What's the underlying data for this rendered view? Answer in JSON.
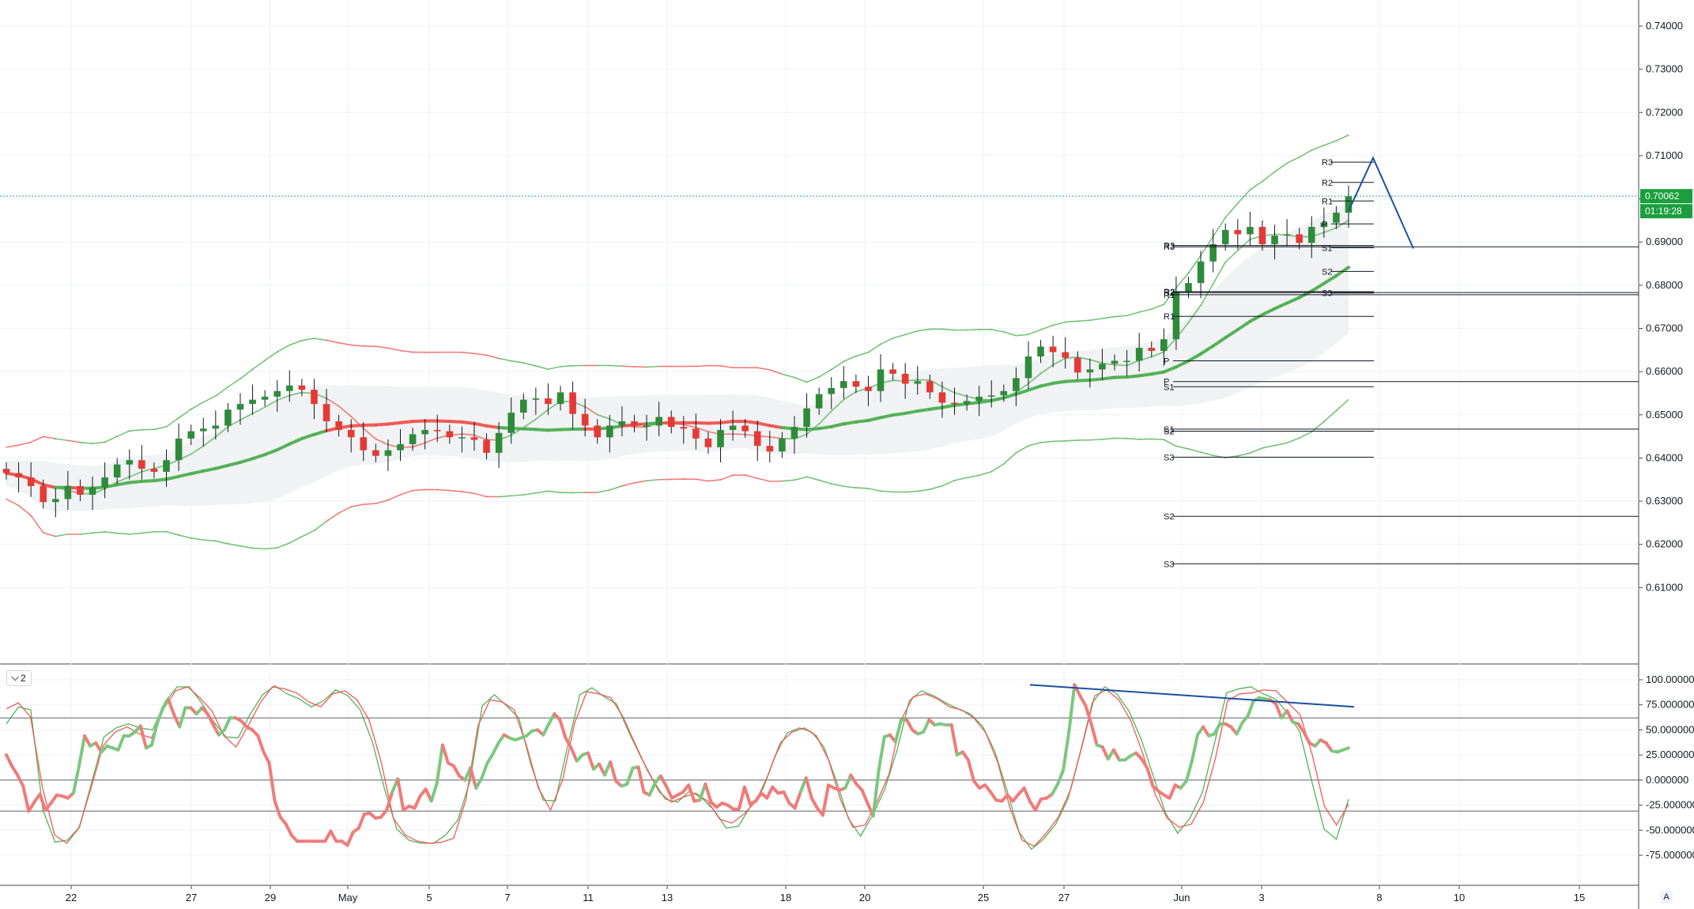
{
  "chart_data": [
    {
      "type": "candlestick",
      "title": "",
      "x_tick_labels": [
        "22",
        "27",
        "29",
        "May",
        "5",
        "7",
        "11",
        "13",
        "18",
        "20",
        "25",
        "27",
        "Jun",
        "3",
        "8",
        "10",
        "15"
      ],
      "y_tick_labels": [
        "0.74000",
        "0.73000",
        "0.72000",
        "0.71000",
        "0.70000",
        "0.69000",
        "0.68000",
        "0.67000",
        "0.66000",
        "0.65000",
        "0.64000",
        "0.63000",
        "0.62000",
        "0.61000"
      ],
      "ylim": [
        0.605,
        0.745
      ],
      "last_price": "0.70062",
      "countdown": "01:19:28",
      "series": [
        {
          "label_description": "close (approx.)",
          "values": [
            0.6365,
            0.6355,
            0.6335,
            0.6298,
            0.6305,
            0.6335,
            0.6315,
            0.6332,
            0.6355,
            0.6385,
            0.6395,
            0.6375,
            0.6368,
            0.6395,
            0.6445,
            0.6462,
            0.6468,
            0.6475,
            0.6512,
            0.6525,
            0.6535,
            0.6542,
            0.6555,
            0.6568,
            0.6558,
            0.6525,
            0.6485,
            0.6465,
            0.6448,
            0.6418,
            0.6405,
            0.6418,
            0.6432,
            0.6455,
            0.6465,
            0.6462,
            0.6448,
            0.6448,
            0.6442,
            0.6412,
            0.6458,
            0.6505,
            0.6535,
            0.6538,
            0.6525,
            0.6552,
            0.6502,
            0.6475,
            0.6448,
            0.6475,
            0.6485,
            0.6475,
            0.6475,
            0.6495,
            0.6472,
            0.6468,
            0.6445,
            0.6425,
            0.6465,
            0.6475,
            0.6462,
            0.6428,
            0.6415,
            0.6445,
            0.6472,
            0.6515,
            0.6548,
            0.6562,
            0.6578,
            0.6565,
            0.6555,
            0.6605,
            0.6595,
            0.6572,
            0.6578,
            0.6552,
            0.6528,
            0.6525,
            0.6532,
            0.6542,
            0.6545,
            0.6555,
            0.6585,
            0.6635,
            0.6658,
            0.6645,
            0.6632,
            0.6598,
            0.6605,
            0.6618,
            0.6625,
            0.6625,
            0.6655,
            0.6648,
            0.6675,
            0.6785,
            0.6805,
            0.6855,
            0.6895,
            0.6928,
            0.6918,
            0.6935,
            0.6895,
            0.6915,
            0.6918,
            0.6898,
            0.6935,
            0.6945,
            0.6968,
            0.7006
          ]
        }
      ],
      "pivot_levels": {
        "week1": {
          "R3": 0.7085,
          "R2": 0.7038,
          "R1": 0.6995,
          "P": 0.6942,
          "S1": 0.6887,
          "S2": 0.6832,
          "S3": 0.6782
        },
        "week2": {
          "R3": 0.6892,
          "R2": 0.6785,
          "R1": 0.6728,
          "P": 0.6625,
          "S1": 0.6565,
          "S2": 0.6462,
          "S3": 0.6402
        },
        "week3": {
          "R3": 0.6889,
          "R2": 0.6783,
          "R1": 0.6778,
          "P": 0.6577,
          "S1": 0.6467,
          "S2": 0.6265,
          "S3": 0.6155
        }
      },
      "projection": {
        "points": [
          [
            0.6972
          ],
          [
            0.7095
          ],
          [
            0.6885
          ]
        ]
      }
    },
    {
      "type": "line",
      "title": "",
      "pane_label": "2",
      "y_tick_labels": [
        "100.000000",
        "75.000000",
        "50.000000",
        "25.000000",
        "0.000000",
        "-25.000000",
        "-50.000000",
        "-75.000000"
      ],
      "ylim": [
        -80,
        105
      ],
      "levels": [
        62,
        0,
        -31
      ],
      "series": [
        {
          "label_description": "main oscillator",
          "values": [
            25,
            14,
            5,
            -6,
            -31,
            -22,
            -14,
            -30,
            -23,
            -15,
            -16,
            -18,
            -13,
            14,
            44,
            34,
            37,
            28,
            34,
            32,
            30,
            44,
            44,
            48,
            54,
            32,
            35,
            57,
            72,
            80,
            65,
            53,
            72,
            72,
            66,
            72,
            66,
            55,
            45,
            50,
            62,
            62,
            59,
            53,
            50,
            44,
            28,
            17,
            -21,
            -37,
            -44,
            -55,
            -61,
            -61,
            -61,
            -61,
            -61,
            -61,
            -51,
            -61,
            -61,
            -65,
            -52,
            -48,
            -34,
            -33,
            -38,
            -37,
            -30,
            -12,
            1,
            -30,
            -26,
            -28,
            -16,
            -9,
            -21,
            -3,
            35,
            17,
            14,
            4,
            0,
            12,
            -8,
            2,
            17,
            26,
            37,
            45,
            42,
            40,
            42,
            44,
            49,
            50,
            45,
            56,
            66,
            60,
            42,
            32,
            19,
            25,
            27,
            11,
            16,
            5,
            18,
            -1,
            -6,
            -4,
            12,
            13,
            -12,
            -15,
            -3,
            4,
            -6,
            -18,
            -15,
            -12,
            -5,
            -21,
            -20,
            -4,
            -22,
            -27,
            -23,
            -25,
            -29,
            -29,
            -7,
            -24,
            -21,
            -13,
            -18,
            -7,
            -13,
            -12,
            -23,
            -28,
            -12,
            2,
            -18,
            -28,
            -35,
            -5,
            -8,
            -10,
            -8,
            5,
            -4,
            -10,
            -23,
            -36,
            10,
            43,
            45,
            38,
            60,
            60,
            50,
            46,
            48,
            60,
            55,
            56,
            55,
            55,
            25,
            28,
            20,
            -1,
            -8,
            -5,
            -12,
            -20,
            -21,
            -15,
            -21,
            -14,
            -8,
            -21,
            -30,
            -19,
            -18,
            -14,
            -4,
            10,
            48,
            95,
            84,
            74,
            56,
            35,
            33,
            21,
            30,
            20,
            20,
            24,
            27,
            21,
            12,
            -6,
            -11,
            -15,
            -18,
            -5,
            -8,
            -1,
            19,
            45,
            53,
            44,
            46,
            56,
            56,
            53,
            46,
            57,
            64,
            79,
            82,
            81,
            80,
            76,
            62,
            69,
            58,
            56,
            48,
            37,
            34,
            40,
            37,
            29,
            28,
            30,
            32
          ]
        },
        {
          "label_description": "fast line (red)",
          "values": [
            71,
            77,
            63,
            -8,
            -55,
            -63,
            -48,
            -8,
            34,
            48,
            53,
            46,
            42,
            71,
            89,
            93,
            82,
            69,
            44,
            33,
            54,
            77,
            93,
            91,
            87,
            78,
            73,
            86,
            89,
            80,
            60,
            18,
            -38,
            -55,
            -61,
            -63,
            -62,
            -58,
            -20,
            54,
            80,
            78,
            70,
            35,
            -8,
            -30,
            0,
            57,
            88,
            86,
            82,
            63,
            36,
            10,
            -12,
            -22,
            -17,
            -13,
            -21,
            -39,
            -43,
            -34,
            -21,
            5,
            37,
            48,
            52,
            44,
            20,
            -20,
            -47,
            -45,
            -22,
            6,
            60,
            83,
            86,
            81,
            73,
            70,
            62,
            47,
            17,
            -28,
            -60,
            -66,
            -53,
            -37,
            -10,
            36,
            84,
            90,
            80,
            59,
            26,
            -14,
            -38,
            -47,
            -44,
            -22,
            22,
            79,
            86,
            87,
            90,
            89,
            77,
            65,
            25,
            -26,
            -45,
            -24
          ]
        },
        {
          "label_description": "slow line (green)",
          "values": [
            56,
            73,
            70,
            -30,
            -62,
            -60,
            -47,
            -2,
            43,
            52,
            56,
            52,
            50,
            78,
            93,
            93,
            77,
            58,
            43,
            42,
            66,
            85,
            94,
            86,
            81,
            73,
            79,
            90,
            84,
            70,
            38,
            -9,
            -49,
            -60,
            -63,
            -63,
            -55,
            -40,
            -1,
            74,
            85,
            74,
            62,
            15,
            -20,
            -21,
            34,
            85,
            92,
            83,
            76,
            48,
            23,
            0,
            -19,
            -22,
            -11,
            -18,
            -30,
            -48,
            -46,
            -26,
            -9,
            24,
            47,
            52,
            48,
            33,
            0,
            -38,
            -56,
            -35,
            -9,
            30,
            79,
            89,
            84,
            77,
            71,
            66,
            54,
            29,
            -10,
            -52,
            -69,
            -59,
            -44,
            -19,
            27,
            77,
            93,
            86,
            69,
            41,
            4,
            -33,
            -53,
            -38,
            -13,
            36,
            87,
            91,
            93,
            86,
            81,
            67,
            48,
            -2,
            -49,
            -59,
            -19
          ]
        }
      ],
      "annotation": "divergence trend line"
    }
  ]
}
